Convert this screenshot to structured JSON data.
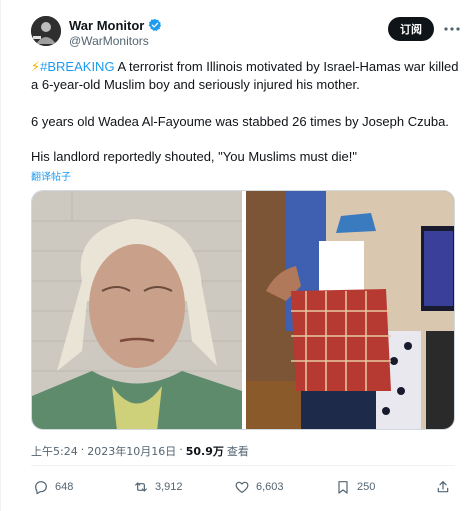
{
  "author": {
    "display_name": "War Monitor",
    "handle": "@WarMonitors",
    "verified": true
  },
  "subscribe_label": "订阅",
  "tweet": {
    "bolt": "⚡",
    "hashtag": "#BREAKING",
    "line1_rest": " A terrorist from Illinois motivated by Israel-Hamas war killed a 6-year-old Muslim boy and seriously injured his mother.",
    "line2": "6 years old Wadea Al-Fayoume was stabbed 26 times by Joseph Czuba.",
    "line3": "His landlord reportedly shouted, \"You Muslims must die!\"",
    "translate_label": "翻译帖子"
  },
  "meta": {
    "time": "上午5:24",
    "separator": "·",
    "date": "2023年10月16日",
    "views_count": "50.9万",
    "views_label": "查看"
  },
  "actions": {
    "replies": "648",
    "reposts": "3,912",
    "likes": "6,603",
    "bookmarks": "250"
  },
  "colors": {
    "accent": "#1d9bf0",
    "text": "#0f1419",
    "muted": "#536471"
  },
  "icons": [
    "verified-badge-icon",
    "more-icon",
    "reply-icon",
    "repost-icon",
    "like-icon",
    "bookmark-icon",
    "share-icon"
  ]
}
